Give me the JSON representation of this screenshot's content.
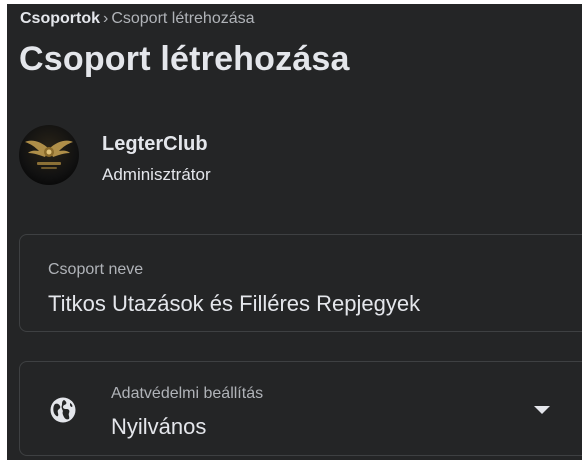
{
  "breadcrumb": {
    "parent": "Csoportok",
    "separator": "›",
    "current": "Csoport létrehozása"
  },
  "page_title": "Csoport létrehozása",
  "owner": {
    "name": "LegterClub",
    "role": "Adminisztrátor",
    "avatar_icon": "legterclub-logo"
  },
  "group_name_field": {
    "label": "Csoport neve",
    "value": "Titkos Utazások és Filléres Repjegyek"
  },
  "privacy_field": {
    "label": "Adatvédelmi beállítás",
    "value": "Nyilvános",
    "icon": "globe-icon",
    "dropdown_icon": "chevron-down-icon"
  },
  "colors": {
    "panel_bg": "#242526",
    "text_primary": "#e4e6eb",
    "text_secondary": "#b0b3b8",
    "border": "#3e4042",
    "logo_gold": "#c9a352"
  }
}
